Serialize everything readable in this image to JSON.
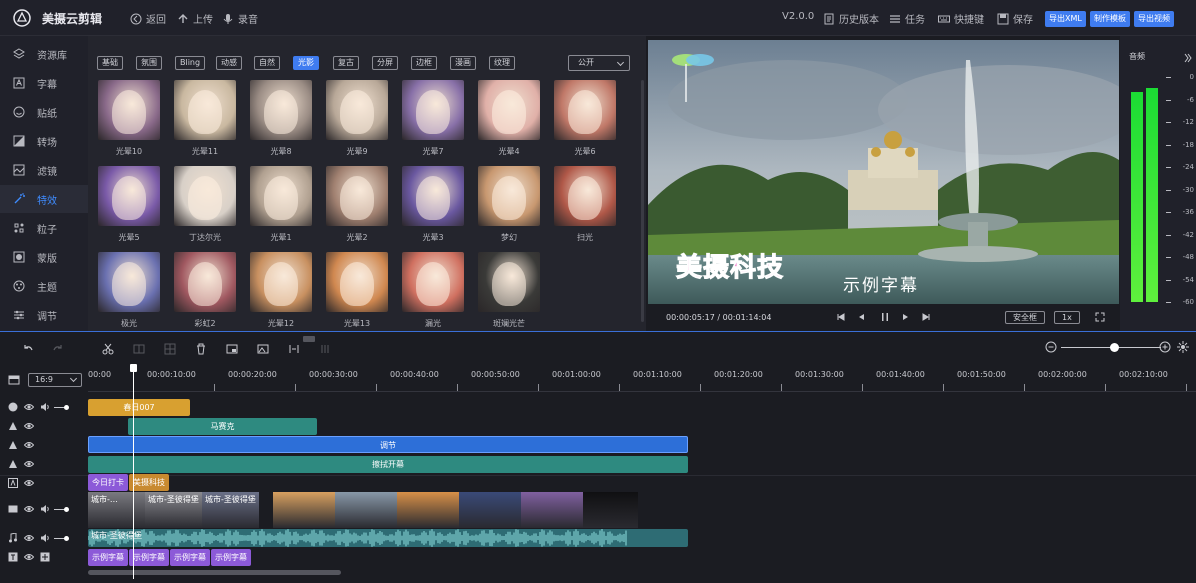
{
  "app": {
    "title": "美摄云剪辑"
  },
  "topbar": {
    "back": "返回",
    "upload": "上传",
    "record": "录音",
    "version": "V2.0.0",
    "history": "历史版本",
    "tasks": "任务",
    "shortcuts": "快捷键",
    "save": "保存",
    "export_xml": "导出XML",
    "make_template": "制作模板",
    "export_video": "导出视频"
  },
  "sidebar": {
    "items": [
      {
        "label": "资源库",
        "icon": "layers-icon"
      },
      {
        "label": "字幕",
        "icon": "text-icon"
      },
      {
        "label": "贴纸",
        "icon": "smile-icon"
      },
      {
        "label": "转场",
        "icon": "transition-icon"
      },
      {
        "label": "滤镜",
        "icon": "filter-icon"
      },
      {
        "label": "特效",
        "icon": "magic-wand-icon",
        "active": true
      },
      {
        "label": "粒子",
        "icon": "particle-icon"
      },
      {
        "label": "蒙版",
        "icon": "mask-icon"
      },
      {
        "label": "主题",
        "icon": "theme-icon"
      },
      {
        "label": "调节",
        "icon": "adjust-icon"
      }
    ]
  },
  "effects": {
    "categories": [
      "基础",
      "氛围",
      "Bling",
      "动感",
      "自然",
      "光影",
      "复古",
      "分屏",
      "边框",
      "漫画",
      "纹理"
    ],
    "active_category": "光影",
    "dropdown": "公开",
    "items": [
      {
        "label": "光晕10",
        "tint": "#8a6a8a"
      },
      {
        "label": "光晕11",
        "tint": "#c9b8a0"
      },
      {
        "label": "光晕8",
        "tint": "#9a8c84"
      },
      {
        "label": "光晕9",
        "tint": "#b8a898"
      },
      {
        "label": "光晕7",
        "tint": "#8870a8"
      },
      {
        "label": "光晕4",
        "tint": "#e0b0a8"
      },
      {
        "label": "光晕6",
        "tint": "#c07868"
      },
      {
        "label": "光晕5",
        "tint": "#7a5aa8"
      },
      {
        "label": "丁达尔光",
        "tint": "#d8d0c8"
      },
      {
        "label": "光晕1",
        "tint": "#b0a090"
      },
      {
        "label": "光晕2",
        "tint": "#a08070"
      },
      {
        "label": "光晕3",
        "tint": "#6a58a0"
      },
      {
        "label": "梦幻",
        "tint": "#c89870"
      },
      {
        "label": "扫光",
        "tint": "#b05848"
      },
      {
        "label": "极光",
        "tint": "#6a70b0"
      },
      {
        "label": "彩虹2",
        "tint": "#a05860"
      },
      {
        "label": "光晕12",
        "tint": "#c89060"
      },
      {
        "label": "光晕13",
        "tint": "#d08850"
      },
      {
        "label": "漏光",
        "tint": "#d07060"
      },
      {
        "label": "斑斓光芒",
        "tint": "#3a3a38"
      }
    ]
  },
  "preview": {
    "title_text": "美摄科技",
    "subtitle": "示例字幕",
    "current_time": "00:00:05:17",
    "total_time": "/ 00:01:14:04",
    "safe_frame": "安全框",
    "speed": "1x"
  },
  "audio": {
    "title": "音频",
    "scale": [
      "0",
      "-6",
      "-12",
      "-18",
      "-24",
      "-30",
      "-36",
      "-42",
      "-48",
      "-54",
      "-60"
    ],
    "left_level_db": -4,
    "right_level_db": -3
  },
  "timeline": {
    "ratio": "16:9",
    "ruler": [
      "00:00",
      "00:00:10:00",
      "00:00:20:00",
      "00:00:30:00",
      "00:00:40:00",
      "00:00:50:00",
      "00:01:00:00",
      "00:01:10:00",
      "00:01:20:00",
      "00:01:30:00",
      "00:01:40:00",
      "00:01:50:00",
      "00:02:00:00",
      "00:02:10:00"
    ],
    "clips": {
      "sticker": "春日007",
      "particle": "马赛克",
      "adjust": "调节",
      "effect": "擦拭开幕",
      "caption_a": "今日打卡",
      "caption_b": "美摄科技",
      "video": [
        "城市-…",
        "城市-圣彼得堡",
        "城市-圣彼得堡"
      ],
      "audio": "城市-圣彼得堡",
      "subtitles": [
        "示例字幕",
        "示例字幕",
        "示例字幕",
        "示例字幕"
      ]
    }
  }
}
